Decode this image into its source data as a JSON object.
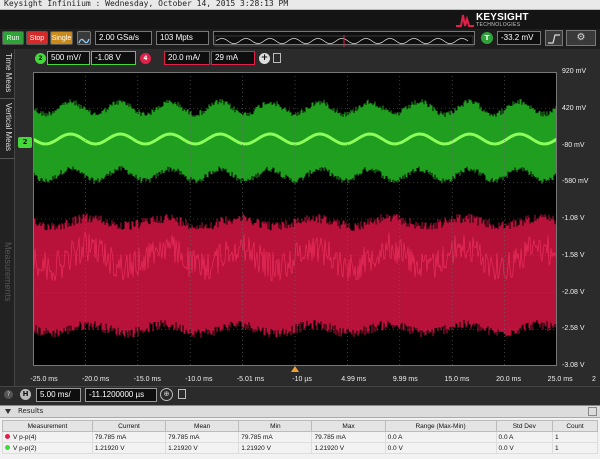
{
  "titlebar": {
    "text": "Keysight Infiniium : Wednesday, October 14, 2015 3:28:13 PM"
  },
  "brand": {
    "name": "KEYSIGHT",
    "sub": "TECHNOLOGIES"
  },
  "toolbar": {
    "run_label": "Run",
    "stop_label": "Stop",
    "single_label": "Single",
    "sample_rate": "2.00 GSa/s",
    "memory_depth": "103 Mpts",
    "trigger_badge": "T",
    "trigger_level": "-33.2 mV"
  },
  "channels": {
    "ch2": {
      "badge": "2",
      "scale": "500 mV/",
      "offset": "-1.08 V",
      "color": "#44d83a"
    },
    "ch4": {
      "badge": "4",
      "scale": "20.0 mA/",
      "offset": "29 mA",
      "color": "#e0224a"
    },
    "add_label": "+"
  },
  "sidetabs": {
    "time": "Time Meas",
    "vertical": "Vertical Meas",
    "measurements": "Measurements"
  },
  "marker_ch2": "2",
  "right_axis": [
    "920 mV",
    "420 mV",
    "-80 mV",
    "-580 mV",
    "-1.08 V",
    "-1.58 V",
    "-2.08 V",
    "-2.58 V",
    "-3.08 V"
  ],
  "bottom_axis": [
    "-25.0 ms",
    "-20.0 ms",
    "-15.0 ms",
    "-10.0 ms",
    "-5.01 ms",
    "-10 µs",
    "4.99 ms",
    "9.99 ms",
    "15.0 ms",
    "20.0 ms",
    "25.0 ms"
  ],
  "bottom_axis_extra": "2",
  "horizontal": {
    "badge": "H",
    "scale": "5.00 ms/",
    "position": "-11.1200000 µs"
  },
  "results": {
    "title": "Results",
    "columns": [
      "Measurement",
      "Current",
      "Mean",
      "Min",
      "Max",
      "Range (Max-Min)",
      "Std Dev",
      "Count"
    ],
    "rows": [
      {
        "name": "V p-p(4)",
        "dot": "#e0224a",
        "values": [
          "79.785 mA",
          "79.785 mA",
          "79.785 mA",
          "79.785 mA",
          "0.0 A",
          "0.0 A",
          "1"
        ]
      },
      {
        "name": "V p-p(2)",
        "dot": "#44d83a",
        "values": [
          "1.21920 V",
          "1.21920 V",
          "1.21920 V",
          "1.21920 V",
          "0.0 V",
          "0.0 V",
          "1"
        ]
      }
    ]
  }
}
